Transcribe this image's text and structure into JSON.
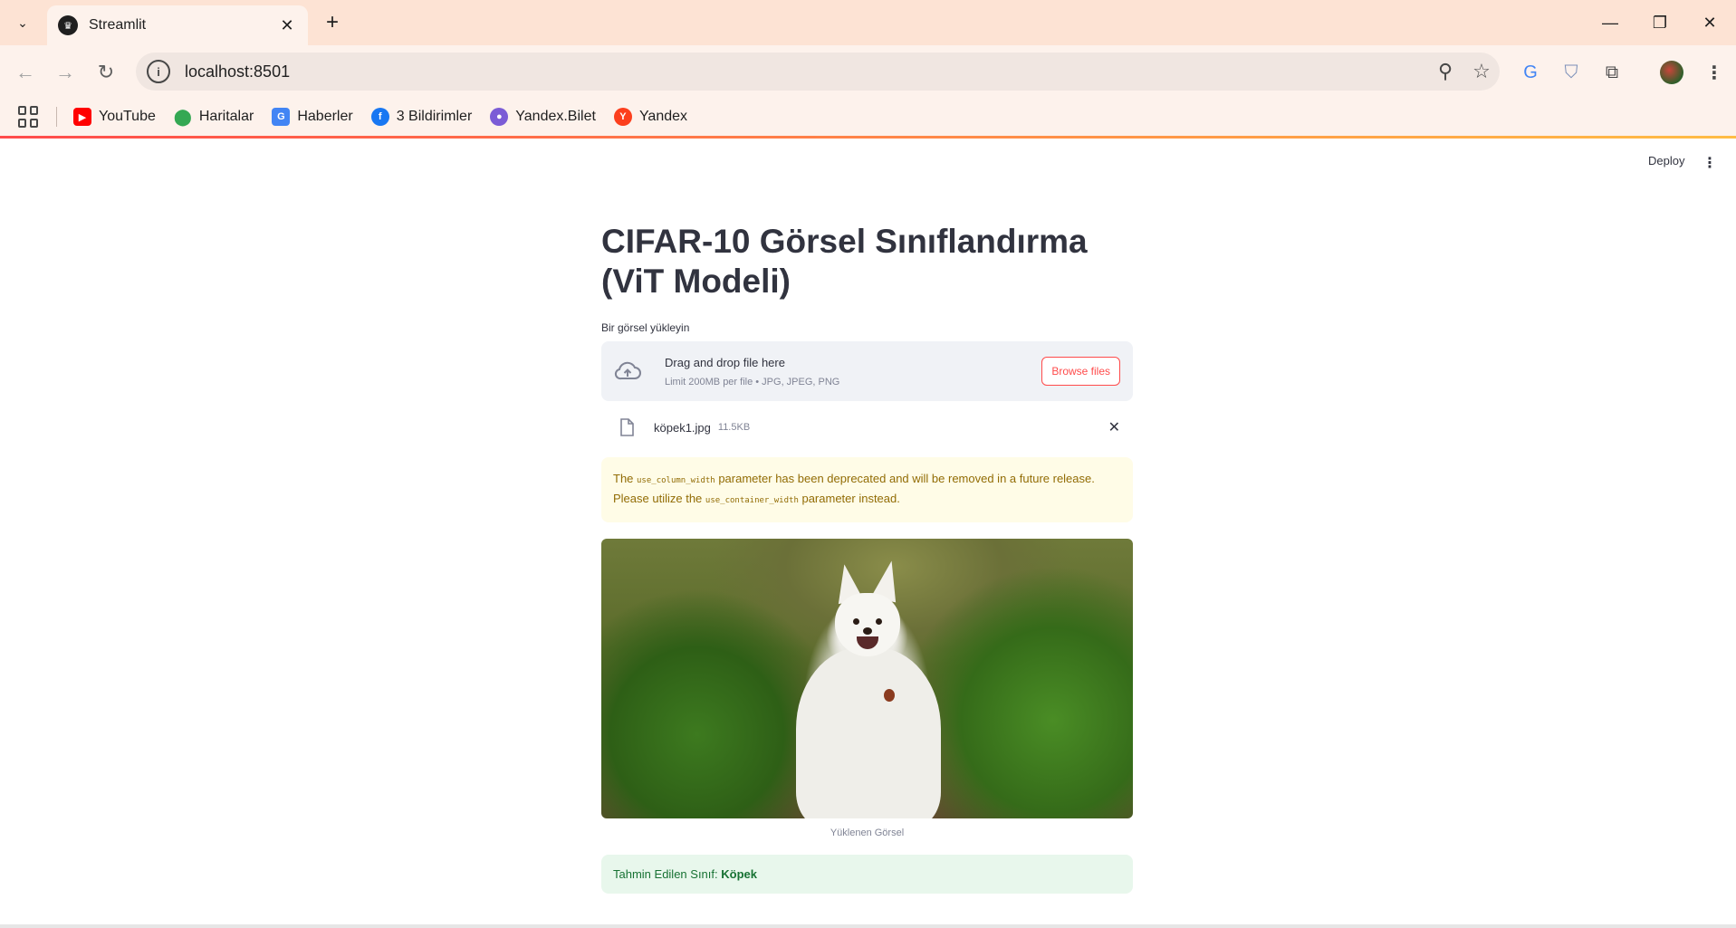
{
  "browser": {
    "tab_title": "Streamlit",
    "url": "localhost:8501",
    "bookmarks": [
      {
        "label": "YouTube",
        "icon": "youtube-icon",
        "color": "#ff0000"
      },
      {
        "label": "Haritalar",
        "icon": "maps-pin-icon",
        "color": "#34a853"
      },
      {
        "label": "Haberler",
        "icon": "news-icon",
        "color": "#4285f4"
      },
      {
        "label": "3 Bildirimler",
        "icon": "facebook-icon",
        "color": "#1877f2"
      },
      {
        "label": "Yandex.Bilet",
        "icon": "yandex-bilet-icon",
        "color": "#7b5cd6"
      },
      {
        "label": "Yandex",
        "icon": "yandex-icon",
        "color": "#fc3f1d"
      }
    ]
  },
  "app": {
    "deploy_label": "Deploy",
    "title": "CIFAR-10 Görsel Sınıflandırma (ViT Modeli)",
    "uploader": {
      "label": "Bir görsel yükleyin",
      "drag_text": "Drag and drop file here",
      "limit_text": "Limit 200MB per file • JPG, JPEG, PNG",
      "browse_label": "Browse files"
    },
    "file": {
      "name": "köpek1.jpg",
      "size": "11.5KB"
    },
    "warning": {
      "text_before": "The ",
      "code1": "use_column_width",
      "text_middle": " parameter has been deprecated and will be removed in a future release. Please utilize the ",
      "code2": "use_container_width",
      "text_after": " parameter instead."
    },
    "image_caption": "Yüklenen Görsel",
    "prediction": {
      "label": "Tahmin Edilen Sınıf: ",
      "value": "Köpek"
    }
  },
  "colors": {
    "accent": "#ff4b4b",
    "warning_bg": "#fffce7",
    "success_bg": "#e8f7ec"
  }
}
